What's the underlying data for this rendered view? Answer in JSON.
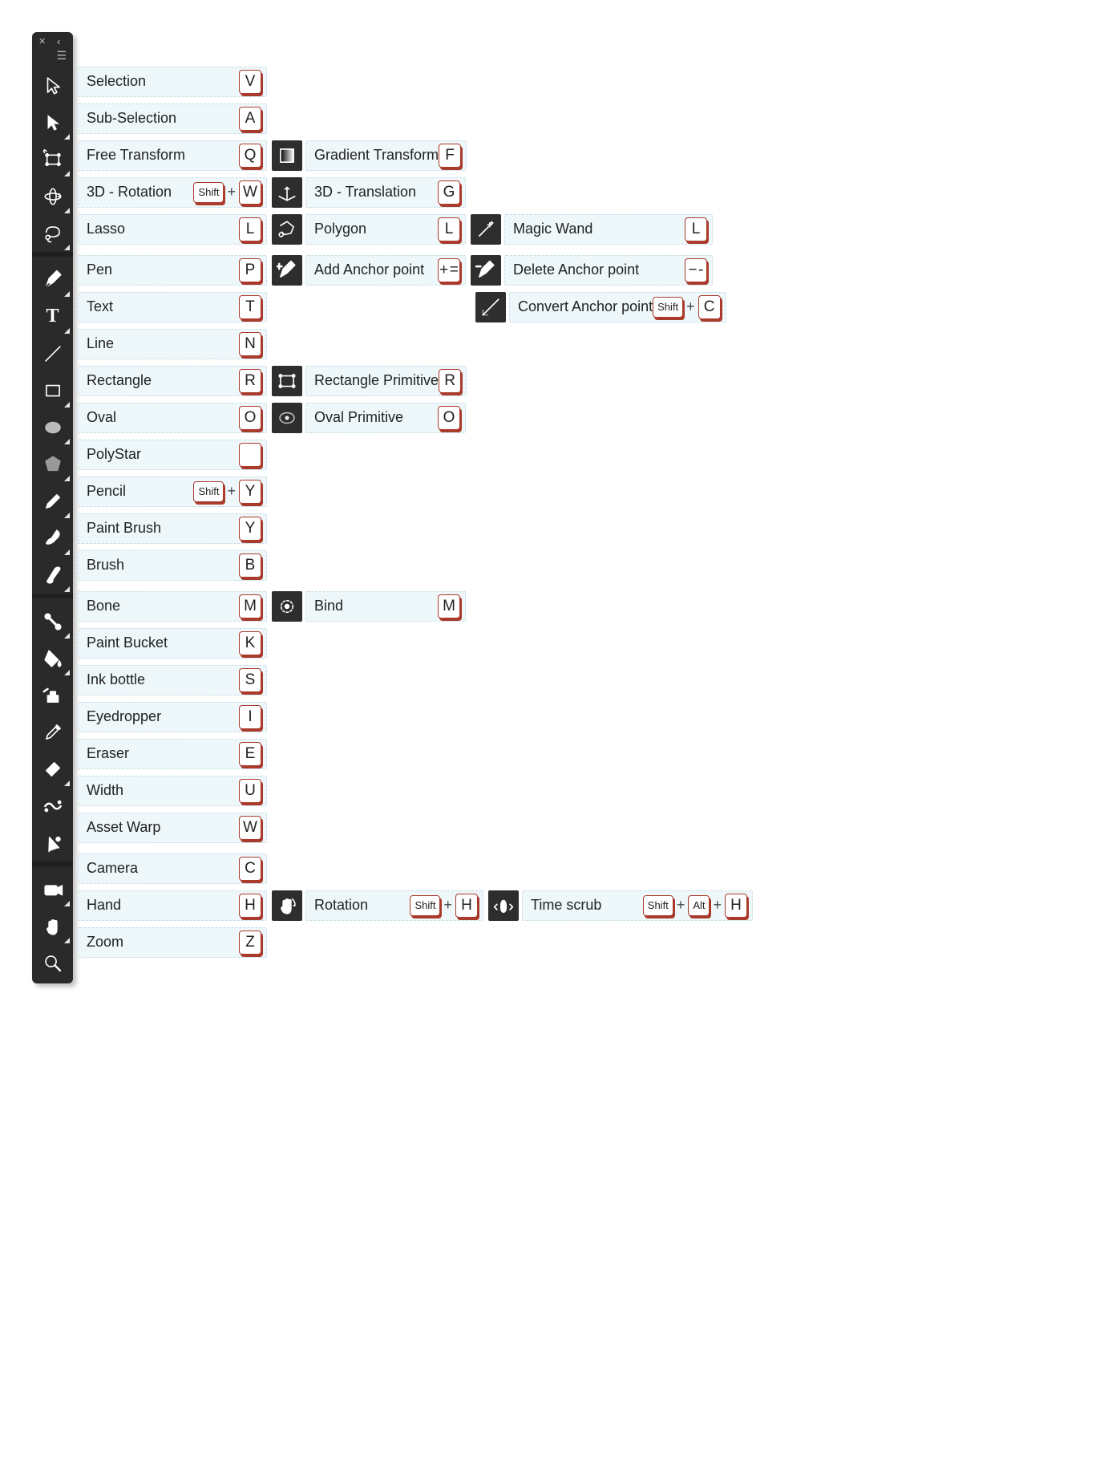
{
  "mods": {
    "shift": "Shift",
    "alt": "Alt"
  },
  "rows": [
    {
      "id": "selection",
      "group": 0,
      "flyout": false,
      "iconLabel": "selection-arrow-icon",
      "main": {
        "name": "Selection",
        "key": "V"
      }
    },
    {
      "id": "subselection",
      "group": 0,
      "flyout": true,
      "iconLabel": "subselection-arrow-icon",
      "main": {
        "name": "Sub-Selection",
        "key": "A"
      }
    },
    {
      "id": "freetransform",
      "group": 0,
      "flyout": true,
      "iconLabel": "free-transform-icon",
      "main": {
        "name": "Free Transform",
        "key": "Q"
      },
      "subs": [
        {
          "id": "gradient-transform",
          "icon": "gradient-transform-icon",
          "name": "Gradient Transform",
          "key": "F"
        }
      ]
    },
    {
      "id": "3d-rotation",
      "group": 0,
      "flyout": true,
      "iconLabel": "3d-rotation-icon",
      "main": {
        "name": "3D - Rotation",
        "mods": [
          "shift"
        ],
        "key": "W"
      },
      "subs": [
        {
          "id": "3d-translation",
          "icon": "3d-translation-icon",
          "name": "3D - Translation",
          "key": "G"
        }
      ]
    },
    {
      "id": "lasso",
      "group": 0,
      "flyout": true,
      "iconLabel": "lasso-icon",
      "main": {
        "name": "Lasso",
        "key": "L"
      },
      "subs": [
        {
          "id": "polygon-lasso",
          "icon": "polygon-lasso-icon",
          "name": "Polygon",
          "key": "L"
        },
        {
          "id": "magic-wand",
          "icon": "magic-wand-icon",
          "name": "Magic Wand",
          "key": "L"
        }
      ]
    },
    {
      "id": "pen",
      "group": 1,
      "flyout": true,
      "iconLabel": "pen-icon",
      "main": {
        "name": "Pen",
        "key": "P"
      },
      "subs": [
        {
          "id": "add-anchor",
          "icon": "add-anchor-icon",
          "name": "Add Anchor point",
          "key": "+ ="
        },
        {
          "id": "delete-anchor",
          "icon": "delete-anchor-icon",
          "name": "Delete Anchor point",
          "key": "− -"
        }
      ]
    },
    {
      "id": "text",
      "group": 1,
      "flyout": true,
      "iconLabel": "text-icon",
      "main": {
        "name": "Text",
        "key": "T"
      },
      "subs": [
        null,
        {
          "id": "convert-anchor",
          "icon": "convert-anchor-icon",
          "name": "Convert Anchor point",
          "mods": [
            "shift"
          ],
          "key": "C"
        }
      ]
    },
    {
      "id": "line",
      "group": 1,
      "flyout": false,
      "iconLabel": "line-icon",
      "main": {
        "name": "Line",
        "key": "N"
      }
    },
    {
      "id": "rectangle",
      "group": 1,
      "flyout": true,
      "iconLabel": "rectangle-icon",
      "main": {
        "name": "Rectangle",
        "key": "R"
      },
      "subs": [
        {
          "id": "rect-primitive",
          "icon": "rectangle-primitive-icon",
          "name": "Rectangle Primitive",
          "key": "R"
        }
      ]
    },
    {
      "id": "oval",
      "group": 1,
      "flyout": true,
      "iconLabel": "oval-icon",
      "main": {
        "name": "Oval",
        "key": "O"
      },
      "subs": [
        {
          "id": "oval-primitive",
          "icon": "oval-primitive-icon",
          "name": "Oval Primitive",
          "key": "O"
        }
      ]
    },
    {
      "id": "polystar",
      "group": 1,
      "flyout": true,
      "iconLabel": "polystar-icon",
      "main": {
        "name": "PolyStar",
        "key": ""
      }
    },
    {
      "id": "pencil",
      "group": 1,
      "flyout": true,
      "iconLabel": "pencil-icon",
      "main": {
        "name": "Pencil",
        "mods": [
          "shift"
        ],
        "key": "Y"
      }
    },
    {
      "id": "paint-brush",
      "group": 1,
      "flyout": true,
      "iconLabel": "paint-brush-icon",
      "main": {
        "name": "Paint Brush",
        "key": "Y"
      }
    },
    {
      "id": "brush",
      "group": 1,
      "flyout": true,
      "iconLabel": "brush-icon",
      "main": {
        "name": "Brush",
        "key": "B"
      }
    },
    {
      "id": "bone",
      "group": 2,
      "flyout": true,
      "iconLabel": "bone-icon",
      "main": {
        "name": "Bone",
        "key": "M"
      },
      "subs": [
        {
          "id": "bind",
          "icon": "bind-icon",
          "name": "Bind",
          "key": "M"
        }
      ]
    },
    {
      "id": "paint-bucket",
      "group": 2,
      "flyout": true,
      "iconLabel": "paint-bucket-icon",
      "main": {
        "name": "Paint Bucket",
        "key": "K"
      }
    },
    {
      "id": "ink-bottle",
      "group": 2,
      "flyout": false,
      "iconLabel": "ink-bottle-icon",
      "main": {
        "name": "Ink bottle",
        "key": "S"
      }
    },
    {
      "id": "eyedropper",
      "group": 2,
      "flyout": false,
      "iconLabel": "eyedropper-icon",
      "main": {
        "name": "Eyedropper",
        "key": "I"
      }
    },
    {
      "id": "eraser",
      "group": 2,
      "flyout": true,
      "iconLabel": "eraser-icon",
      "main": {
        "name": "Eraser",
        "key": "E"
      }
    },
    {
      "id": "width",
      "group": 2,
      "flyout": false,
      "iconLabel": "width-icon",
      "main": {
        "name": "Width",
        "key": "U"
      }
    },
    {
      "id": "asset-warp",
      "group": 2,
      "flyout": false,
      "iconLabel": "asset-warp-icon",
      "main": {
        "name": "Asset Warp",
        "key": "W"
      }
    },
    {
      "id": "camera",
      "group": 3,
      "flyout": true,
      "iconLabel": "camera-icon",
      "main": {
        "name": "Camera",
        "key": "C"
      }
    },
    {
      "id": "hand",
      "group": 3,
      "flyout": true,
      "iconLabel": "hand-icon",
      "main": {
        "name": "Hand",
        "key": "H"
      },
      "subs": [
        {
          "id": "rotation-hand",
          "icon": "rotation-hand-icon",
          "name": "Rotation",
          "mods": [
            "shift"
          ],
          "key": "H",
          "cls": "w-sub-hand"
        },
        {
          "id": "time-scrub",
          "icon": "time-scrub-icon",
          "name": "Time scrub",
          "mods": [
            "shift",
            "alt"
          ],
          "key": "H",
          "cls": "w-sub-time"
        }
      ]
    },
    {
      "id": "zoom",
      "group": 3,
      "flyout": false,
      "iconLabel": "zoom-icon",
      "main": {
        "name": "Zoom",
        "key": "Z"
      }
    }
  ]
}
